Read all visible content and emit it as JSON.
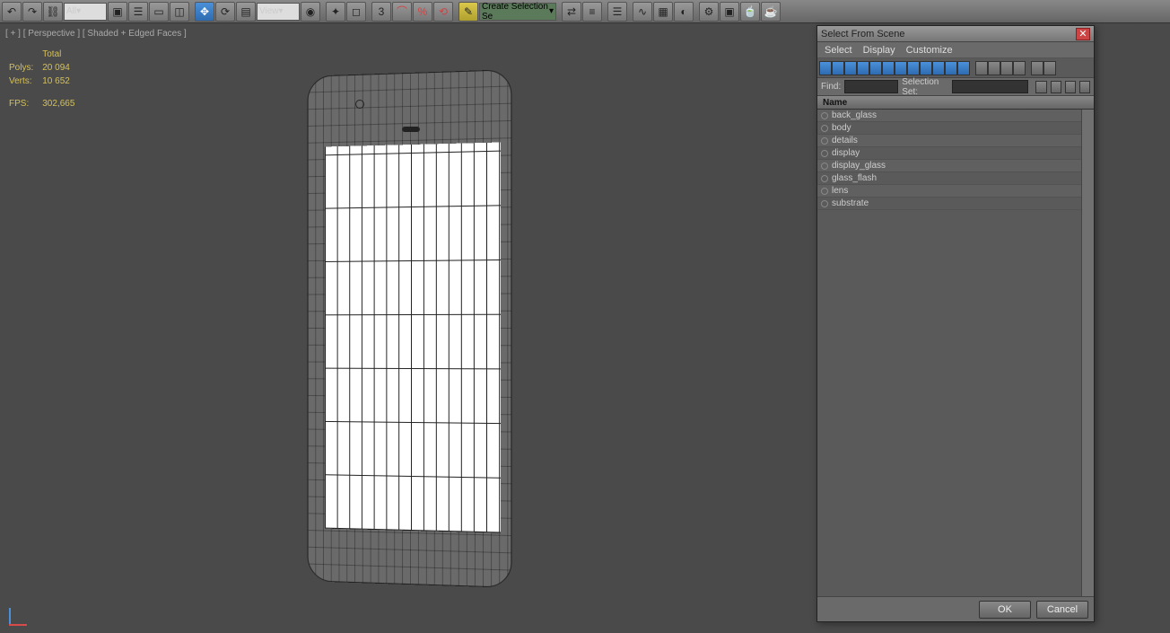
{
  "toolbar": {
    "dropdown_all": "All",
    "dropdown_view": "View",
    "create_sel": "Create Selection Se"
  },
  "viewport": {
    "label": "[ + ] [ Perspective ] [ Shaded + Edged Faces ]"
  },
  "stats": {
    "total_label": "Total",
    "polys_label": "Polys:",
    "polys_value": "20 094",
    "verts_label": "Verts:",
    "verts_value": "10 652",
    "fps_label": "FPS:",
    "fps_value": "302,665"
  },
  "dialog": {
    "title": "Select From Scene",
    "menu": {
      "select": "Select",
      "display": "Display",
      "customize": "Customize"
    },
    "find_label": "Find:",
    "find_value": "",
    "selset_label": "Selection Set:",
    "header_name": "Name",
    "items": [
      "back_glass",
      "body",
      "details",
      "display",
      "display_glass",
      "glass_flash",
      "lens",
      "substrate"
    ],
    "ok": "OK",
    "cancel": "Cancel"
  }
}
